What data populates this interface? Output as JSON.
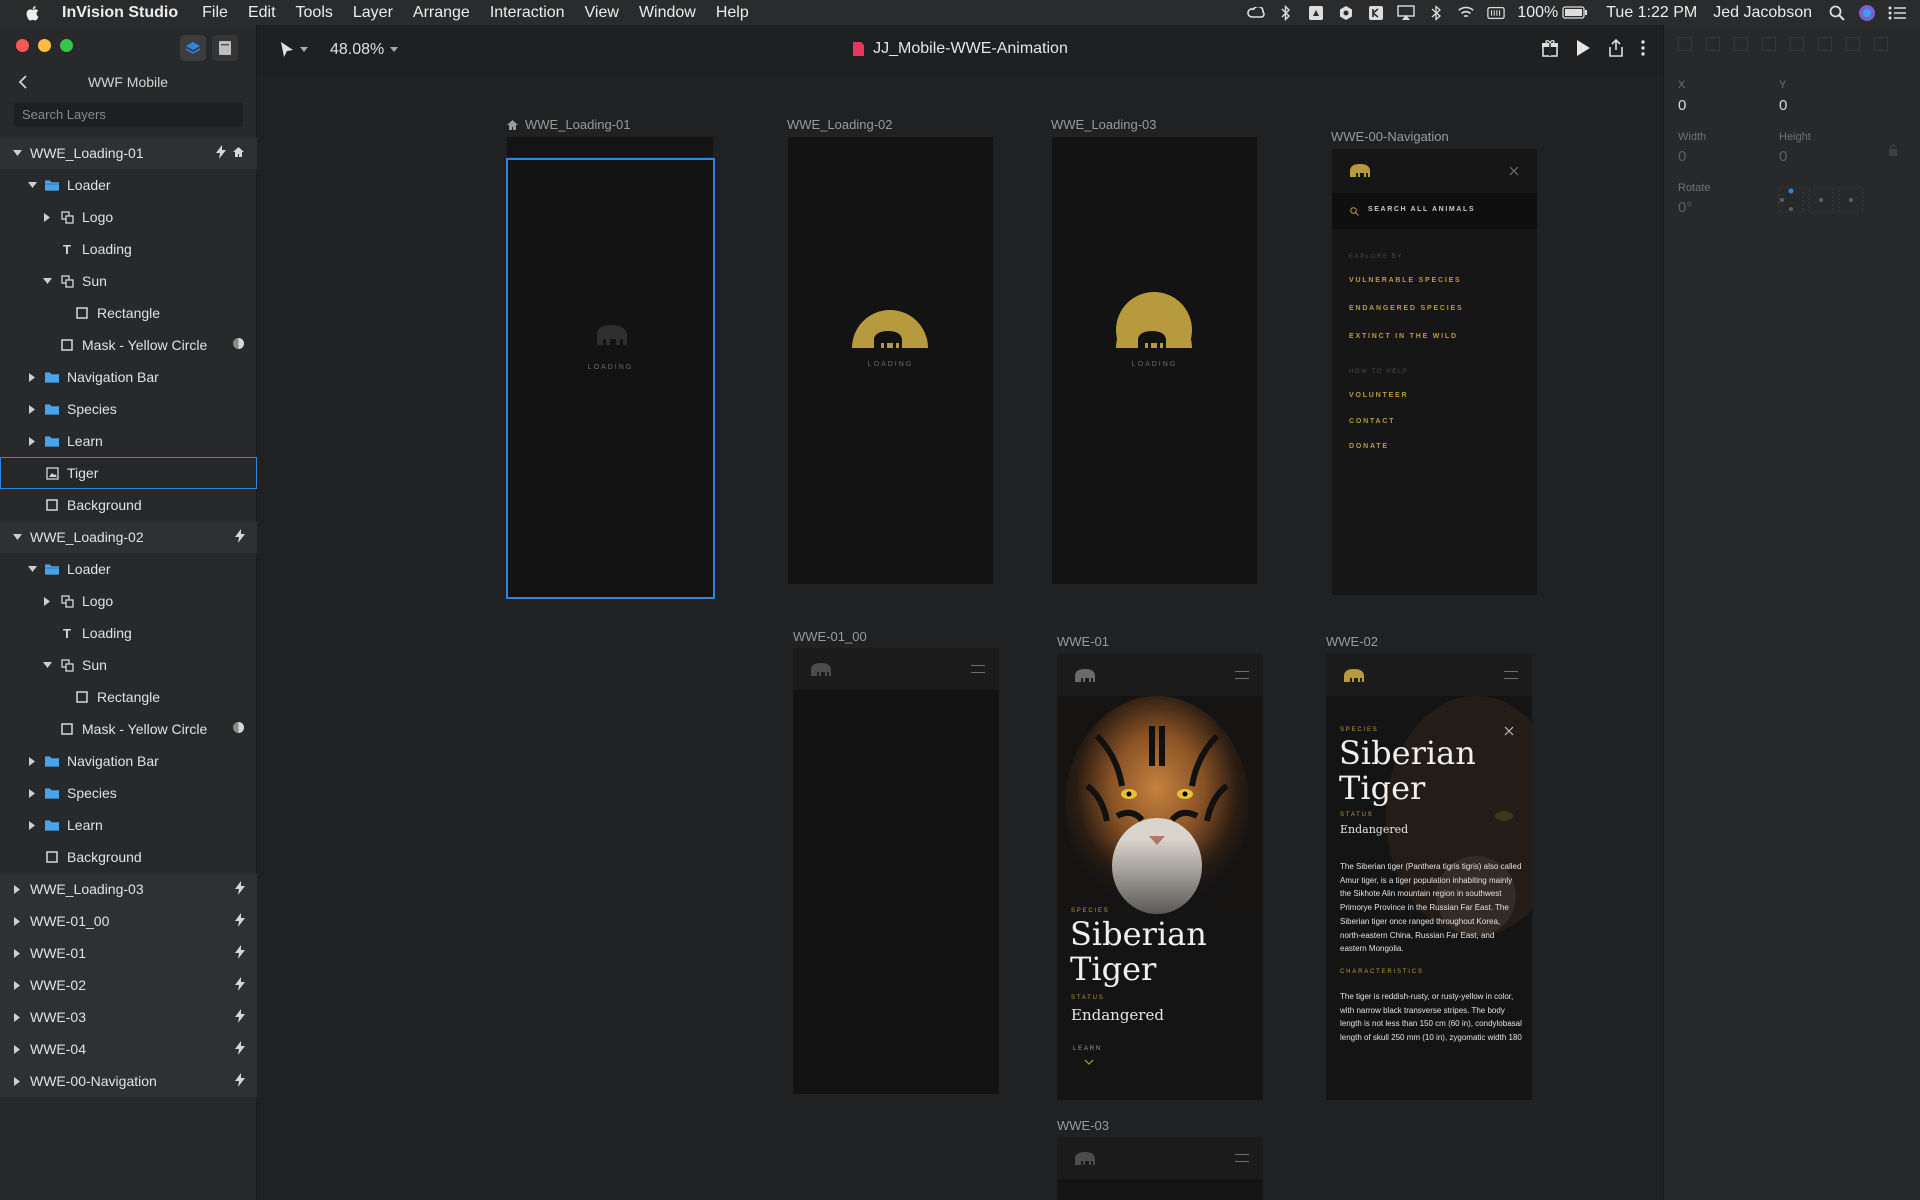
{
  "menubar": {
    "app_name": "InVision Studio",
    "items": [
      "File",
      "Edit",
      "Tools",
      "Layer",
      "Arrange",
      "Interaction",
      "View",
      "Window",
      "Help"
    ],
    "battery": "100%",
    "clock": "Tue 1:22 PM",
    "user": "Jed Jacobson"
  },
  "left_panel": {
    "project_title": "WWF Mobile",
    "search_placeholder": "Search Layers",
    "layers": [
      {
        "label": "WWE_Loading-01",
        "kind": "board",
        "depth": 0,
        "expanded": true,
        "trail": [
          "bolt",
          "home"
        ]
      },
      {
        "label": "Loader",
        "kind": "folder-open",
        "depth": 1,
        "expanded": true
      },
      {
        "label": "Logo",
        "kind": "group",
        "depth": 2,
        "expanded": false
      },
      {
        "label": "Loading",
        "kind": "text",
        "depth": 2
      },
      {
        "label": "Sun",
        "kind": "group",
        "depth": 2,
        "expanded": true
      },
      {
        "label": "Rectangle",
        "kind": "rect",
        "depth": 3
      },
      {
        "label": "Mask - Yellow Circle",
        "kind": "rect",
        "depth": 2,
        "trail": [
          "mask"
        ]
      },
      {
        "label": "Navigation Bar",
        "kind": "folder",
        "depth": 1,
        "expanded": false
      },
      {
        "label": "Species",
        "kind": "folder",
        "depth": 1,
        "expanded": false
      },
      {
        "label": "Learn",
        "kind": "folder",
        "depth": 1,
        "expanded": false
      },
      {
        "label": "Tiger",
        "kind": "image",
        "depth": 1,
        "selected": true
      },
      {
        "label": "Background",
        "kind": "rect",
        "depth": 1
      },
      {
        "label": "WWE_Loading-02",
        "kind": "board",
        "depth": 0,
        "expanded": true,
        "trail": [
          "bolt"
        ]
      },
      {
        "label": "Loader",
        "kind": "folder-open",
        "depth": 1,
        "expanded": true
      },
      {
        "label": "Logo",
        "kind": "group",
        "depth": 2,
        "expanded": false
      },
      {
        "label": "Loading",
        "kind": "text",
        "depth": 2
      },
      {
        "label": "Sun",
        "kind": "group",
        "depth": 2,
        "expanded": true
      },
      {
        "label": "Rectangle",
        "kind": "rect",
        "depth": 3
      },
      {
        "label": "Mask - Yellow Circle",
        "kind": "rect",
        "depth": 2,
        "trail": [
          "mask"
        ]
      },
      {
        "label": "Navigation Bar",
        "kind": "folder",
        "depth": 1,
        "expanded": false
      },
      {
        "label": "Species",
        "kind": "folder",
        "depth": 1,
        "expanded": false
      },
      {
        "label": "Learn",
        "kind": "folder",
        "depth": 1,
        "expanded": false
      },
      {
        "label": "Background",
        "kind": "rect",
        "depth": 1
      },
      {
        "label": "WWE_Loading-03",
        "kind": "board",
        "depth": 0,
        "expanded": false,
        "trail": [
          "bolt"
        ]
      },
      {
        "label": "WWE-01_00",
        "kind": "board",
        "depth": 0,
        "expanded": false,
        "trail": [
          "bolt"
        ]
      },
      {
        "label": "WWE-01",
        "kind": "board",
        "depth": 0,
        "expanded": false,
        "trail": [
          "bolt"
        ]
      },
      {
        "label": "WWE-02",
        "kind": "board",
        "depth": 0,
        "expanded": false,
        "trail": [
          "bolt"
        ]
      },
      {
        "label": "WWE-03",
        "kind": "board",
        "depth": 0,
        "expanded": false,
        "trail": [
          "bolt"
        ]
      },
      {
        "label": "WWE-04",
        "kind": "board",
        "depth": 0,
        "expanded": false,
        "trail": [
          "bolt"
        ]
      },
      {
        "label": "WWE-00-Navigation",
        "kind": "board",
        "depth": 0,
        "expanded": false,
        "trail": [
          "bolt"
        ]
      }
    ]
  },
  "topbar": {
    "zoom": "48.08%",
    "document_title": "JJ_Mobile-WWE-Animation"
  },
  "canvas": {
    "boards": {
      "loading01": {
        "label": "WWE_Loading-01",
        "loading": "LOADING"
      },
      "loading02": {
        "label": "WWE_Loading-02",
        "loading": "LOADING"
      },
      "loading03": {
        "label": "WWE_Loading-03",
        "loading": "LOADING"
      },
      "nav": {
        "label": "WWE-00-Navigation",
        "search": "SEARCH ALL ANIMALS",
        "explore_heading": "EXPLORE BY",
        "explore_items": [
          "VULNERABLE SPECIES",
          "ENDANGERED SPECIES",
          "EXTINCT IN THE WILD"
        ],
        "help_heading": "HOW TO HELP",
        "help_items": [
          "VOLUNTEER",
          "CONTACT",
          "DONATE"
        ]
      },
      "wwe0100": {
        "label": "WWE-01_00"
      },
      "wwe01": {
        "label": "WWE-01",
        "species_tag": "SPECIES",
        "name_line1": "Siberian",
        "name_line2": "Tiger",
        "status_tag": "STATUS",
        "status": "Endangered",
        "learn": "LEARN"
      },
      "wwe02": {
        "label": "WWE-02",
        "species_tag": "SPECIES",
        "name_line1": "Siberian",
        "name_line2": "Tiger",
        "status_tag": "STATUS",
        "status": "Endangered",
        "description": "The Siberian tiger (Panthera tigris tigris) also called Amur tiger, is a tiger population inhabiting mainly the Sikhote Alin mountain region in southwest Primorye Province in the Russian Far East. The Siberian tiger once ranged throughout Korea, north-eastern China, Russian Far East, and eastern Mongolia.",
        "characteristics_tag": "CHARACTERISTICS",
        "characteristics": "The tiger is reddish-rusty, or rusty-yellow in color, with narrow black transverse stripes. The body length is not less than 150 cm (60 in), condylobasal length of skull 250 mm (10 in), zygomatic width 180"
      },
      "wwe03": {
        "label": "WWE-03"
      }
    }
  },
  "inspector": {
    "x_label": "X",
    "x_value": "0",
    "y_label": "Y",
    "y_value": "0",
    "width_label": "Width",
    "width_value": "0",
    "height_label": "Height",
    "height_value": "0",
    "rotate_label": "Rotate",
    "rotate_value": "0°"
  },
  "colors": {
    "accent_blue": "#2f86e0",
    "gold": "#b89a3e",
    "folder_blue": "#4aa3e8",
    "doc_pink": "#e8365f"
  }
}
